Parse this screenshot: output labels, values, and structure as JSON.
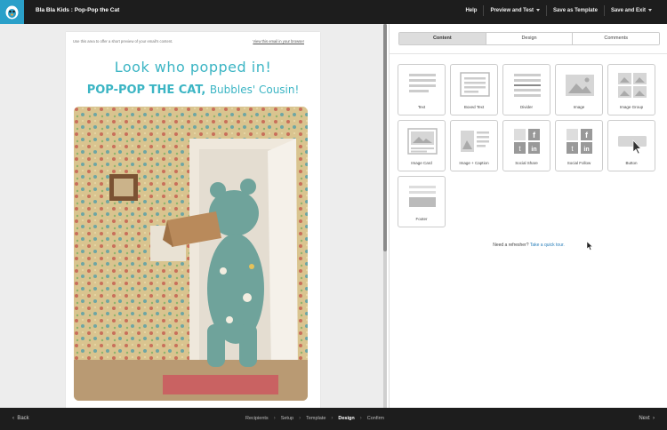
{
  "header": {
    "title": "Bla Bla Kids : Pop-Pop the Cat",
    "actions": [
      "Help",
      "Preview and Test",
      "Save as Template",
      "Save and Exit"
    ]
  },
  "preview": {
    "preheader": "Use this area to offer a short preview of your email's content.",
    "view_in_browser": "View this email in your browser",
    "headline_line1": "Look who popped in!",
    "headline_line2_bold": "POP-POP THE CAT,",
    "headline_line2_thin": "Bubbles' Cousin!"
  },
  "panel": {
    "tabs": [
      "Content",
      "Design",
      "Comments"
    ],
    "active_tab": "Content",
    "blocks": [
      {
        "label": "Text",
        "icon": "text-block-icon"
      },
      {
        "label": "Boxed Text",
        "icon": "boxed-text-block-icon"
      },
      {
        "label": "Divider",
        "icon": "divider-block-icon"
      },
      {
        "label": "Image",
        "icon": "image-block-icon"
      },
      {
        "label": "Image Group",
        "icon": "image-group-block-icon"
      },
      {
        "label": "Image Card",
        "icon": "image-card-block-icon"
      },
      {
        "label": "Image + Caption",
        "icon": "image-caption-block-icon"
      },
      {
        "label": "Social Share",
        "icon": "social-share-block-icon"
      },
      {
        "label": "Social Follow",
        "icon": "social-follow-block-icon"
      },
      {
        "label": "Button",
        "icon": "button-block-icon"
      },
      {
        "label": "Footer",
        "icon": "footer-block-icon"
      }
    ],
    "help_text": "Need a refresher?",
    "help_link": "Take a quick tour."
  },
  "footer": {
    "back": "Back",
    "next": "Next",
    "steps": [
      "Recipients",
      "Setup",
      "Template",
      "Design",
      "Confirm"
    ],
    "active_step": "Design"
  }
}
